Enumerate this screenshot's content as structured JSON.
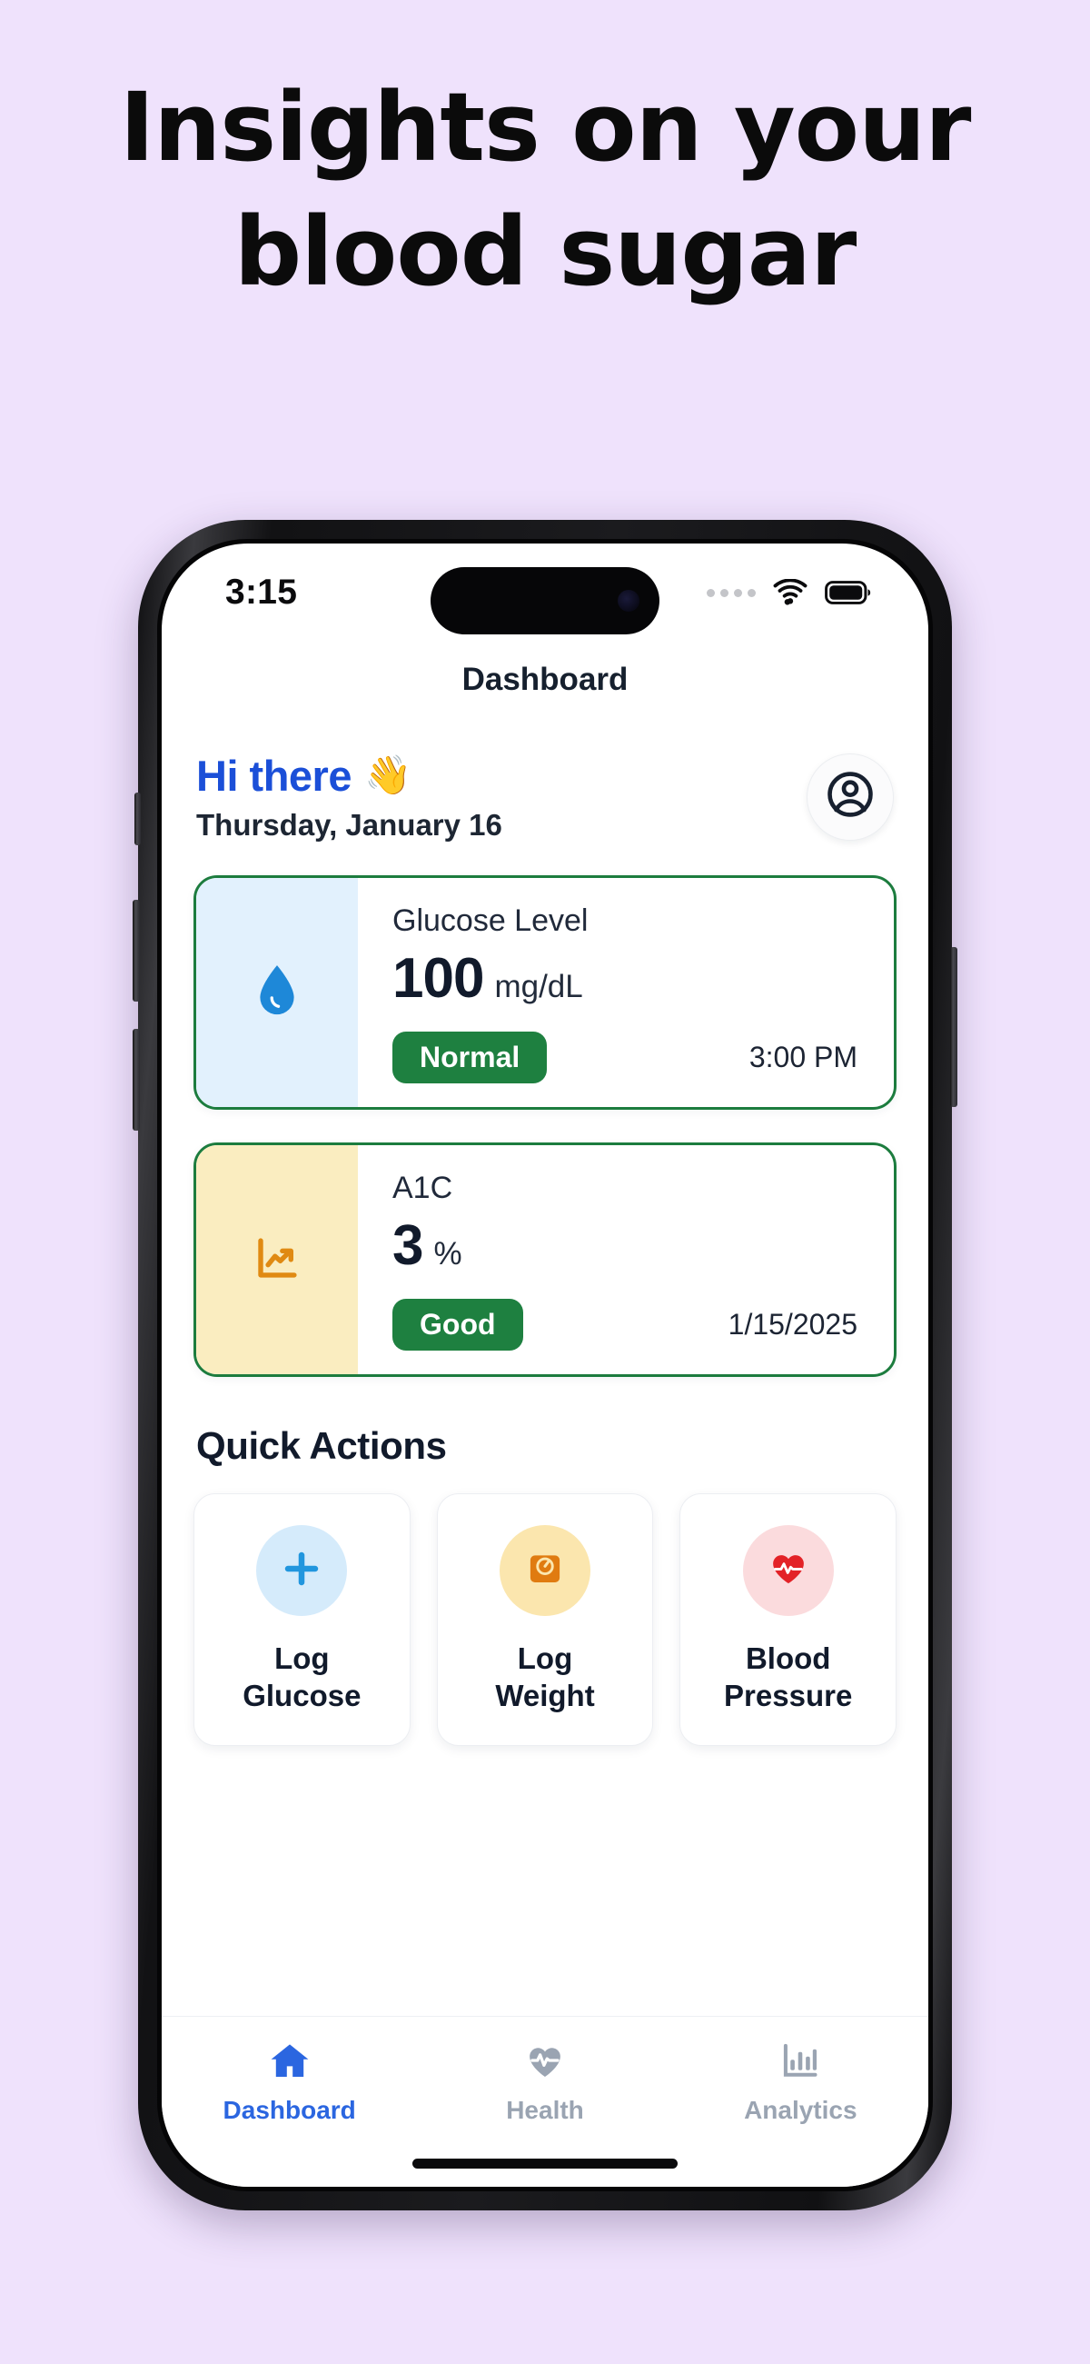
{
  "marketing": {
    "headline_line1": "Insights on your",
    "headline_line2": "blood sugar",
    "background_color": "#EFE2FC"
  },
  "status_bar": {
    "time": "3:15",
    "signal_icon": "signal-dots-icon",
    "wifi_icon": "wifi-icon",
    "battery_icon": "battery-full-icon"
  },
  "nav": {
    "title": "Dashboard"
  },
  "greeting": {
    "hello": "Hi there",
    "wave_emoji": "👋",
    "date": "Thursday, January 16",
    "avatar_icon": "account-circle-icon",
    "hello_color": "#1B4FD8"
  },
  "metrics": [
    {
      "icon": "water-drop-icon",
      "label": "Glucose Level",
      "value": "100",
      "unit": "mg/dL",
      "status": "Normal",
      "timestamp": "3:00 PM",
      "pane_color": "#E2F1FD",
      "border_color": "#1C7C3E",
      "badge_color": "#1E8040"
    },
    {
      "icon": "chart-trending-up-icon",
      "label": "A1C",
      "value": "3",
      "unit": "%",
      "status": "Good",
      "timestamp": "1/15/2025",
      "pane_color": "#FAEDC0",
      "border_color": "#1C7C3E",
      "badge_color": "#1E8040"
    }
  ],
  "quick_actions": {
    "title": "Quick Actions",
    "items": [
      {
        "icon": "plus-icon",
        "label_line1": "Log",
        "label_line2": "Glucose",
        "circle_color": "#D5EBFB",
        "icon_color": "#2196DE"
      },
      {
        "icon": "scale-icon",
        "label_line1": "Log",
        "label_line2": "Weight",
        "circle_color": "#FBE6AE",
        "icon_color": "#E07B10"
      },
      {
        "icon": "heart-pulse-icon",
        "label_line1": "Blood",
        "label_line2": "Pressure",
        "circle_color": "#FBDBDD",
        "icon_color": "#E32227"
      }
    ]
  },
  "tab_bar": {
    "items": [
      {
        "icon": "home-icon",
        "label": "Dashboard",
        "active": true,
        "color": "#2B66E0"
      },
      {
        "icon": "heart-pulse-icon",
        "label": "Health",
        "active": false,
        "color": "#9aa4b2"
      },
      {
        "icon": "bar-chart-icon",
        "label": "Analytics",
        "active": false,
        "color": "#9aa4b2"
      }
    ]
  }
}
